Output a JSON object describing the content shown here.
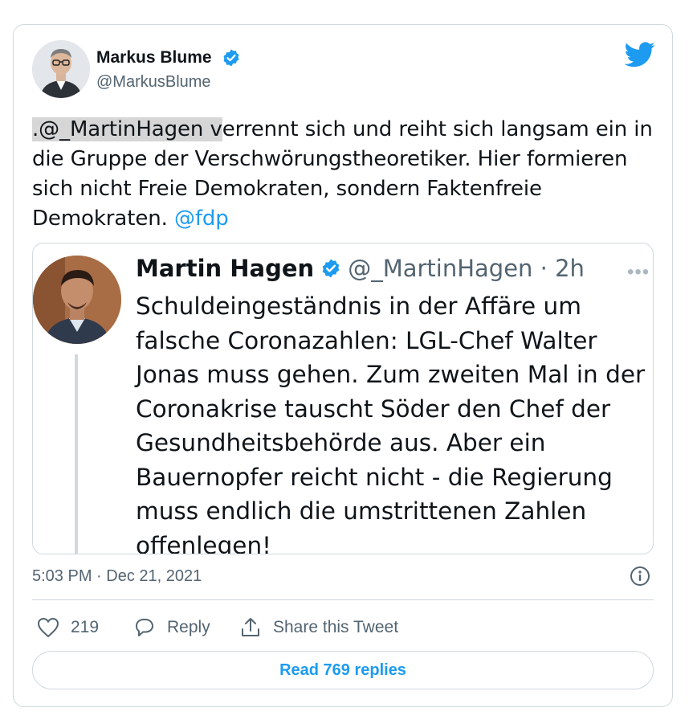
{
  "author": {
    "name": "Markus Blume",
    "handle": "@MarkusBlume"
  },
  "tweet": {
    "text_mention": ".@_MartinHagen v",
    "text_body": "errennt sich und reiht sich langsam ein in die Gruppe der Verschwörungstheoretiker. Hier formieren sich nicht Freie Demokraten, sondern Faktenfreie Demokraten. ",
    "text_link": "@fdp",
    "timestamp": "5:03 PM · Dec 21, 2021"
  },
  "quoted": {
    "name": "Martin Hagen",
    "handle": "@_MartinHagen",
    "time": "· 2h",
    "more": "•••",
    "text": "Schuldeingeständnis in der Affäre um falsche Coronazahlen: LGL-Chef Walter Jonas muss gehen. Zum zweiten Mal in der Coronakrise tauscht Söder den Chef der Gesundheitsbehörde aus. Aber ein Bauernopfer reicht nicht - die Regierung muss endlich die umstrittenen Zahlen offenlegen!"
  },
  "actions": {
    "like_count": "219",
    "reply_label": "Reply",
    "share_label": "Share this Tweet"
  },
  "read_replies_label": "Read 769 replies",
  "icons": {
    "brand": "twitter-bird-icon",
    "verified": "verified-badge-icon",
    "info": "info-icon",
    "like": "heart-icon",
    "reply": "speech-bubble-icon",
    "share": "share-upload-icon"
  },
  "colors": {
    "accent": "#1d9bf0",
    "text": "#0f1419",
    "secondary": "#536471",
    "border": "#cfd9de"
  }
}
